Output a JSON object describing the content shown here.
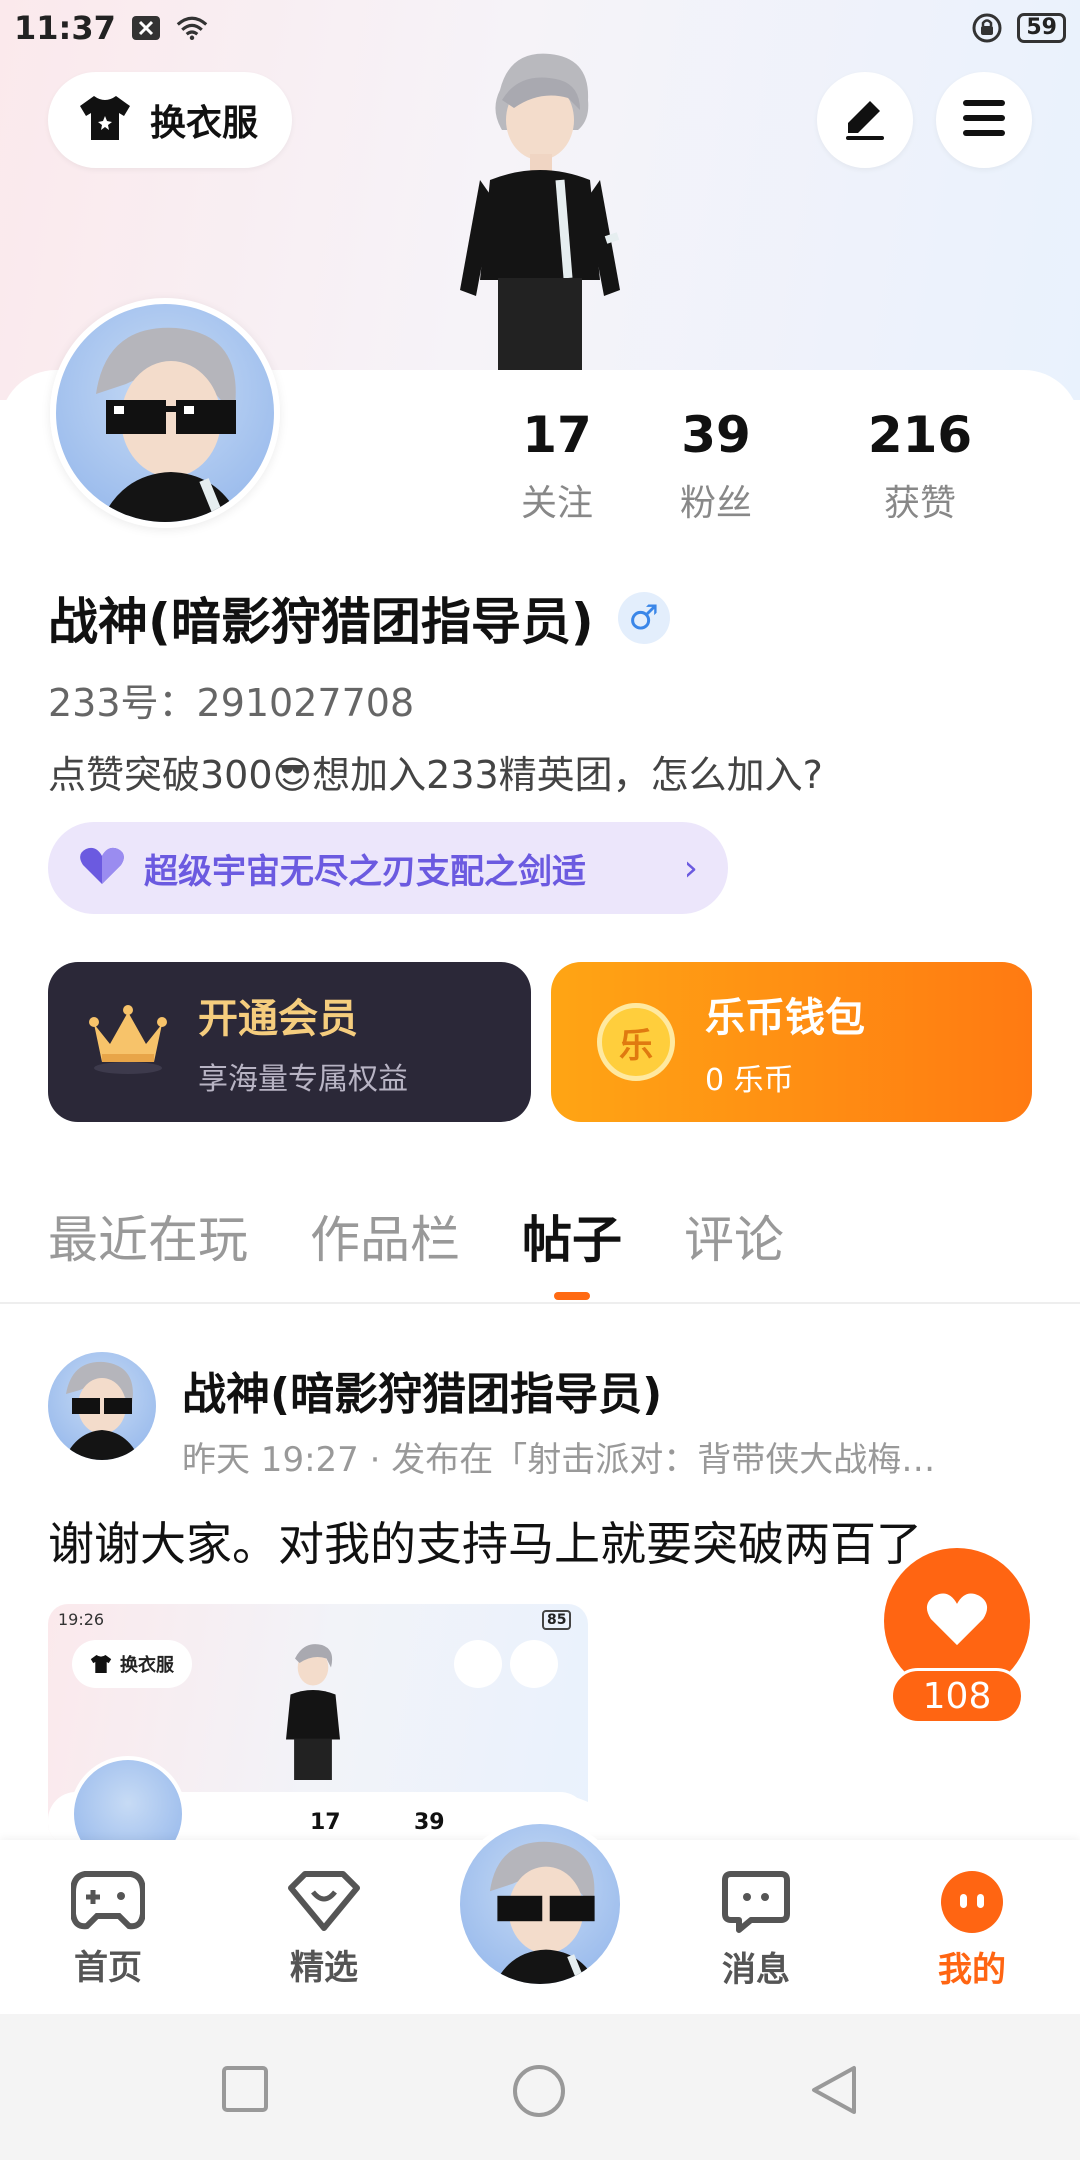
{
  "status_bar": {
    "time": "11:37",
    "battery": "59"
  },
  "header": {
    "outfit_label": "换衣服"
  },
  "profile": {
    "username": "战神(暗影狩猎团指导员)",
    "gender_symbol": "♂",
    "user_id": "233号：291027708",
    "bio": "点赞突破300😎想加入233精英团，怎么加入?",
    "guild_title": "超级宇宙无尽之刃支配之剑适",
    "stats": [
      {
        "value": "17",
        "label": "关注"
      },
      {
        "value": "39",
        "label": "粉丝"
      },
      {
        "value": "216",
        "label": "获赞"
      }
    ]
  },
  "cards": {
    "vip": {
      "title": "开通会员",
      "subtitle": "享海量专属权益"
    },
    "coin": {
      "title": "乐币钱包",
      "subtitle": "0 乐币",
      "coin_char": "乐"
    }
  },
  "tabs": [
    "最近在玩",
    "作品栏",
    "帖子",
    "评论"
  ],
  "active_tab": "帖子",
  "post": {
    "author": "战神(暗影狩猎团指导员)",
    "meta": "昨天 19:27 · 发布在「射击派对：背带侠大战梅…",
    "text": "谢谢大家。对我的支持马上就要突破两百了",
    "likes": "108",
    "image": {
      "time": "19:26",
      "battery": "85",
      "outfit_label": "换衣服",
      "stat1": "17",
      "stat2": "39"
    }
  },
  "bottom_nav": [
    {
      "label": "首页",
      "icon": "gamepad-icon"
    },
    {
      "label": "精选",
      "icon": "heart-gem-icon"
    },
    {
      "label": "消息",
      "icon": "chat-bubble-icon"
    },
    {
      "label": "我的",
      "icon": "face-dots-icon",
      "active": true
    }
  ],
  "colors": {
    "accent": "#ff6512",
    "guild": "#6b5ae0",
    "vip_gold": "#f5cd7e"
  }
}
